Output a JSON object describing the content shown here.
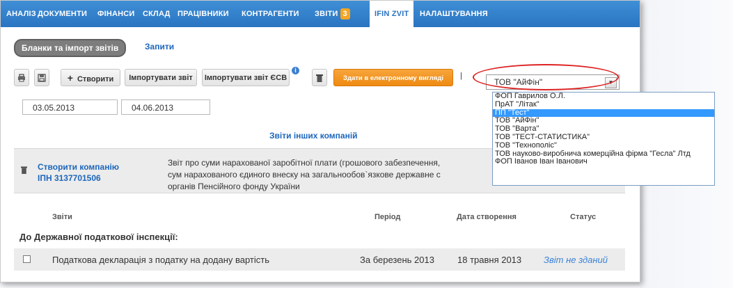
{
  "nav": {
    "items": [
      "АНАЛІЗ",
      "ДОКУМЕНТИ",
      "ФІНАНСИ",
      "СКЛАД",
      "ПРАЦІВНИКИ",
      "КОНТРАГЕНТИ"
    ],
    "reports_label": "ЗВІТИ",
    "reports_badge": "3",
    "active_tab": "IFIN ZVIT",
    "settings": "НАЛАШТУВАННЯ"
  },
  "subtabs": {
    "forms": "Бланки та імпорт звітів",
    "requests": "Запити"
  },
  "toolbar": {
    "create": "Створити",
    "import": "Імпортувати звіт",
    "import_esv": "Імпортувати звіт ЄСВ",
    "info": "i",
    "submit": "Здати в електронному вигляді",
    "separator": "|"
  },
  "dates": {
    "from": "03.05.2013",
    "to": "04.06.2013"
  },
  "company_select": {
    "selected": "ТОВ \"АйФін\"",
    "options": [
      "ФОП Гаврилов О.Л.",
      "ПрАТ \"Літак\"",
      "ПП \"Тест\"",
      "ТОВ \"АйФін\"",
      "ТОВ \"Варта\"",
      "ТОВ \"ТЕСТ-СТАТИСТИКА\"",
      "ТОВ \"Технополіс\"",
      "ТОВ науково-виробнича комерційна фірма \"Гесла\" Лтд",
      "ФОП Іванов Іван Іванович"
    ],
    "highlighted": "ПП \"Тест\""
  },
  "other_companies": {
    "title": "Звіти інших компаній",
    "create_company": "Створити компанію",
    "inn": "ІПН 3137701506",
    "description_lines": [
      "Звіт про суми нарахованої заробітної плати (грошового забезпечення,",
      "сум нарахованого єдиного внеску на загальнообов`язкове державне с",
      "органів Пенсійного фонду України"
    ]
  },
  "table": {
    "headers": {
      "reports": "Звіти",
      "period": "Період",
      "created": "Дата створення",
      "status": "Статус"
    },
    "group": "До Державної податкової інспекції:",
    "rows": [
      {
        "name": "Податкова декларація з податку на додану вартість",
        "period": "За березень 2013",
        "created": "18 травня 2013",
        "status": "Звіт не зданий"
      }
    ]
  },
  "icons": [
    "print-icon",
    "save-icon",
    "plus-icon",
    "info-icon",
    "trash-icon",
    "dropdown-arrow-icon"
  ],
  "colors": {
    "nav": "#2a74c2",
    "link": "#1d66bb",
    "accent": "#ee8a12",
    "highlight": "#3399ff",
    "annotation": "#dd2222"
  }
}
